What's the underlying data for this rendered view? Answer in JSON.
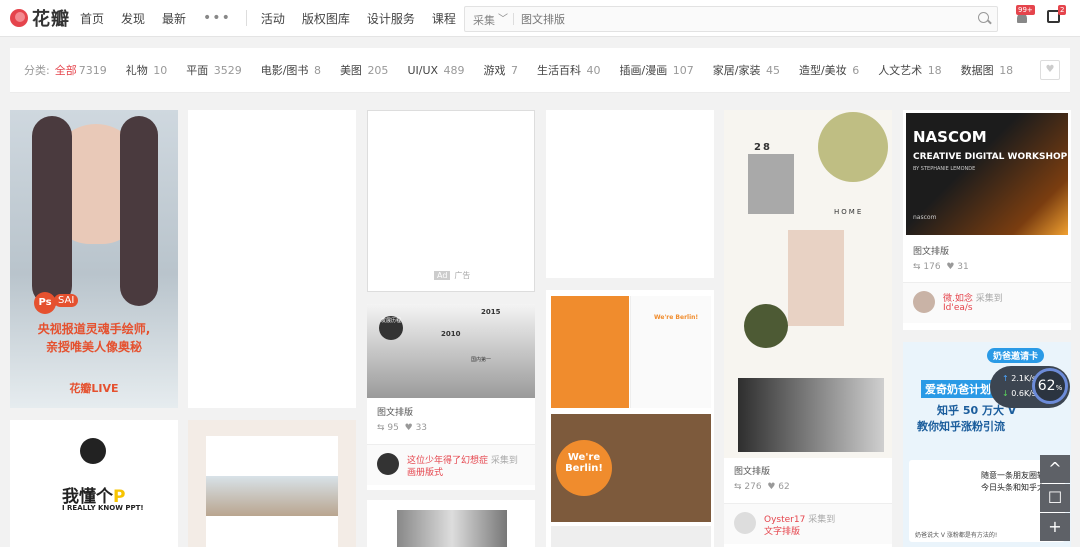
{
  "header": {
    "logo_text": "花瓣",
    "nav": [
      "首页",
      "发现",
      "最新"
    ],
    "more": "•••",
    "nav2": [
      "活动",
      "版权图库",
      "设计服务",
      "课程",
      "美物"
    ],
    "search_category": "采集",
    "search_placeholder": "图文排版",
    "notif_badge": "99+",
    "msg_badge": "2"
  },
  "categories": {
    "label": "分类:",
    "items": [
      {
        "name": "全部",
        "count": "7319"
      },
      {
        "name": "礼物",
        "count": "10"
      },
      {
        "name": "平面",
        "count": "3529"
      },
      {
        "name": "电影/图书",
        "count": "8"
      },
      {
        "name": "美图",
        "count": "205"
      },
      {
        "name": "UI/UX",
        "count": "489"
      },
      {
        "name": "游戏",
        "count": "7"
      },
      {
        "name": "生活百科",
        "count": "40"
      },
      {
        "name": "插画/漫画",
        "count": "107"
      },
      {
        "name": "家居/家装",
        "count": "45"
      },
      {
        "name": "造型/美妆",
        "count": "6"
      },
      {
        "name": "人文艺术",
        "count": "18"
      },
      {
        "name": "数据图",
        "count": "18"
      }
    ]
  },
  "pins": {
    "ad1": {
      "line1": "央视报道灵魂手绘师,",
      "line2": "亲授唯美人像奥秘",
      "brand": "花瓣LIVE",
      "tags": [
        "Ps",
        "SAI"
      ]
    },
    "ad3": {
      "ad_badge": "Ad",
      "ad_label": "广告"
    },
    "pin_c3": {
      "title": "图文排版",
      "repins": "95",
      "likes": "33",
      "user": "这位少年得了幻想症",
      "action": "采集到",
      "board": "画册版式",
      "year1": "2015",
      "year2": "2010",
      "tag1": "发展历程",
      "tag2": "国内第一"
    },
    "pin_c4": {
      "banner1": "We're Berlin!",
      "banner2": "We're Berlin!"
    },
    "pin_c5": {
      "title": "图文排版",
      "repins": "276",
      "likes": "62",
      "user": "Oyster17",
      "action": "采集到",
      "board": "文字排版",
      "num": "28",
      "word": "HOME"
    },
    "pin_c6": {
      "poster1": "NASCOM",
      "poster2": "CREATIVE DIGITAL WORKSHOP",
      "by": "BY STEPHANIE LEMONDE",
      "brand": "nascom",
      "title": "图文排版",
      "repins": "176",
      "likes": "31",
      "user": "微.如念",
      "action": "采集到",
      "board": "Id'ea/s"
    },
    "pin_c6b": {
      "tag": "奶爸邀请卡",
      "l1": "爱奇奶爸计划",
      "l2": "知乎 50 万大 V",
      "l3": "教你知乎涨粉引流",
      "l4": "随意一条朋友圈转发",
      "l5": "今日头条和知乎大V",
      "l6": "奶爸说大 V 涨粉都是有方法的!"
    },
    "pin_c1b": {
      "l1": "我懂个",
      "l1b": "P",
      "l2": "I REALLY KNOW PPT!"
    }
  },
  "speed": {
    "up": "2.1K/s",
    "down": "0.6K/s",
    "pct": "62",
    "unit": "%"
  },
  "fab": {
    "top": "^",
    "chat": "☐",
    "add": "+"
  }
}
